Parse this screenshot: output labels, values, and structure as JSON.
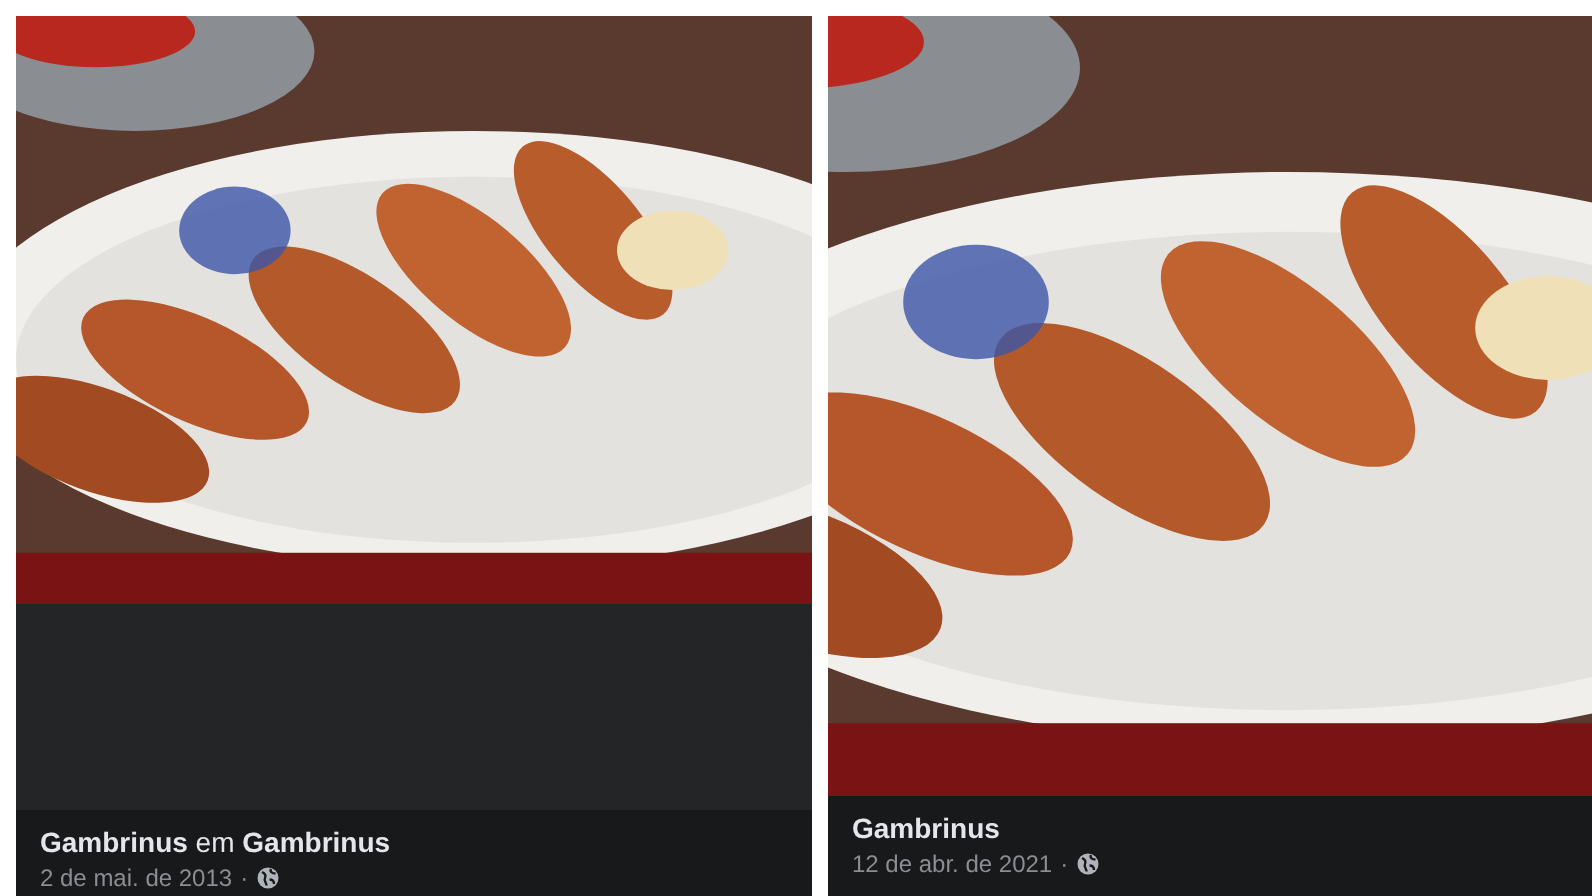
{
  "posts": [
    {
      "author": "Gambrinus",
      "connector": "em",
      "place": "Gambrinus",
      "date": "2 de mai. de 2013",
      "separator": "·"
    },
    {
      "author": "Gambrinus",
      "date": "12 de abr. de 2021",
      "separator": "·"
    }
  ]
}
